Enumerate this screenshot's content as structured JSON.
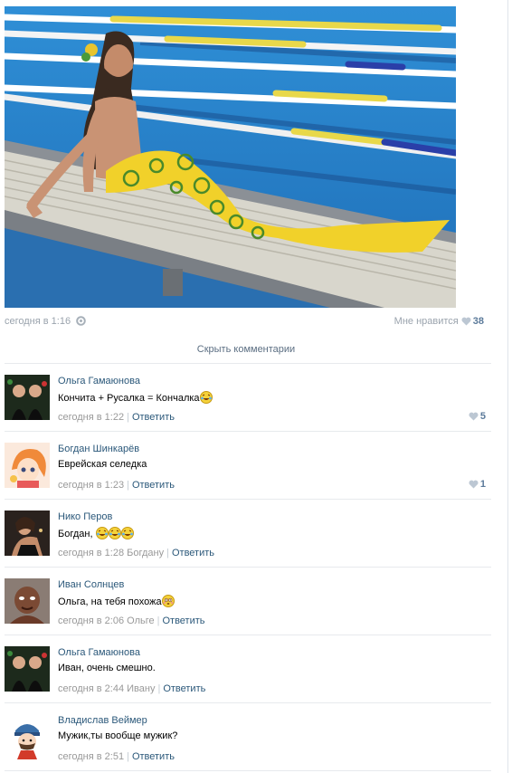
{
  "post": {
    "time": "сегодня в 1:16",
    "like_label": "Мне нравится",
    "like_count": "38",
    "hide_comments": "Скрыть комментарии"
  },
  "comments": [
    {
      "author": "Ольга Гамаюнова",
      "text": "Кончита + Русалка = Кончалка",
      "emoji": "laughing-tears-emoji",
      "time": "сегодня в 1:22",
      "reply": "Ответить",
      "likes": "5"
    },
    {
      "author": "Богдан Шинкарёв",
      "text": "Еврейская селедка",
      "time": "сегодня в 1:23",
      "reply": "Ответить",
      "likes": "1"
    },
    {
      "author": "Нико Перов",
      "text": "Богдан,",
      "emoji": "laughing-tears-emoji",
      "time": "сегодня в 1:28 Богдану",
      "reply": "Ответить"
    },
    {
      "author": "Иван Солнцев",
      "text": "Ольга, на тебя похожа",
      "emoji": "flushed-emoji",
      "time": "сегодня в 2:06 Ольге",
      "reply": "Ответить"
    },
    {
      "author": "Ольга Гамаюнова",
      "text": "Иван, очень смешно.",
      "time": "сегодня в 2:44 Ивану",
      "reply": "Ответить"
    },
    {
      "author": "Владислав Веймер",
      "text": "Мужик,ты вообще мужик?",
      "time": "сегодня в 2:51",
      "reply": "Ответить"
    }
  ]
}
